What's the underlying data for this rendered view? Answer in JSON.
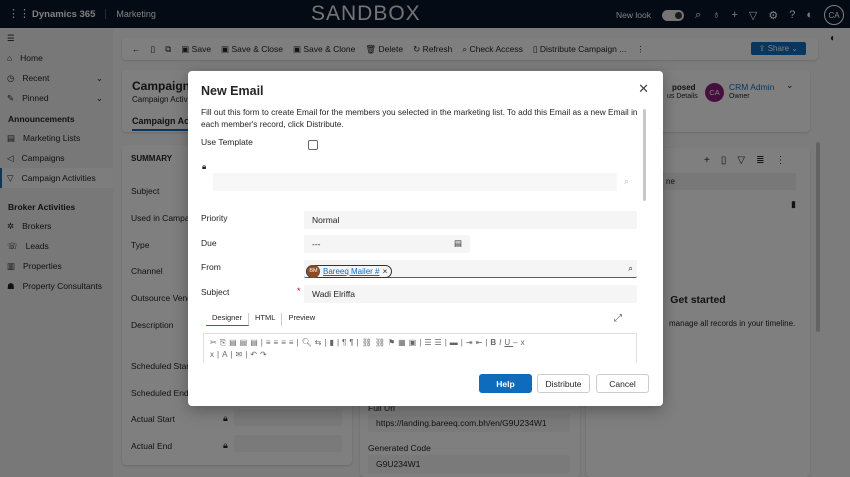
{
  "header": {
    "app": "Dynamics 365",
    "module": "Marketing",
    "env": "SANDBOX",
    "new_look": "New look",
    "avatar": "CA"
  },
  "sidebar": {
    "items": [
      {
        "label": "Home",
        "icon": "home-icon"
      },
      {
        "label": "Recent",
        "icon": "clock-icon"
      },
      {
        "label": "Pinned",
        "icon": "pin-icon"
      }
    ],
    "section1": "Announcements",
    "group1": [
      "Marketing Lists",
      "Campaigns",
      "Campaign Activities"
    ],
    "section2": "Broker Activities",
    "group2": [
      "Brokers",
      "Leads",
      "Properties",
      "Property Consultants"
    ]
  },
  "command": {
    "save": "Save",
    "save_close": "Save & Close",
    "save_clone": "Save & Clone",
    "delete": "Delete",
    "refresh": "Refresh",
    "check_access": "Check Access",
    "distribute": "Distribute Campaign ...",
    "share": "Share"
  },
  "record": {
    "title": "Campaign",
    "subtitle": "Campaign Activi",
    "tab": "Campaign Ac",
    "status": "posed",
    "status_sub": "us Details",
    "owner": "CRM Admin",
    "owner_role": "Owner",
    "owner_initials": "CA"
  },
  "summary": {
    "heading": "SUMMARY",
    "fields": [
      "Subject",
      "Used in Campaig",
      "Type",
      "Channel",
      "Outsource Vend",
      "Description",
      "Scheduled Start",
      "Scheduled End",
      "Actual Start",
      "Actual End"
    ]
  },
  "middle": {
    "full_url_label": "Full Url",
    "full_url": "https://landing.bareeq.com.bh/en/G9U234W1",
    "code_label": "Generated Code",
    "code": "G9U234W1"
  },
  "timeline": {
    "col": "ne",
    "empty_title": "Get started",
    "empty_text": "manage all records in your timeline."
  },
  "modal": {
    "title": "New Email",
    "description": "Fill out this form to create Email for the members you selected in the marketing list. To add this Email as a new Email in each member's record, click Distribute.",
    "use_template": "Use Template",
    "use_template_checked": false,
    "priority_label": "Priority",
    "priority": "Normal",
    "due_label": "Due",
    "due": "---",
    "from_label": "From",
    "from_initials": "BM",
    "from": "Bareeq Mailer #",
    "subject_label": "Subject",
    "subject": "Wadi Elriffa",
    "tabs": [
      "Designer",
      "HTML",
      "Preview"
    ],
    "active_tab": "Designer",
    "help": "Help",
    "distribute": "Distribute",
    "cancel": "Cancel"
  }
}
